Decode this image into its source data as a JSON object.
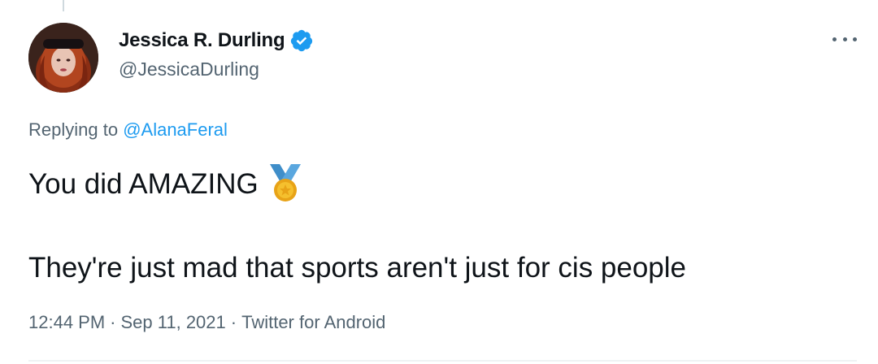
{
  "author": {
    "display_name": "Jessica R. Durling",
    "handle": "@JessicaDurling",
    "verified": true
  },
  "reply": {
    "prefix": "Replying to ",
    "mention": "@AlanaFeral"
  },
  "tweet": {
    "line1": "You did AMAZING",
    "line1_emoji": "medal-icon",
    "line2": "They're just mad that sports aren't just for cis people"
  },
  "meta": {
    "time": "12:44 PM",
    "separator": "·",
    "date": "Sep 11, 2021",
    "source": "Twitter for Android"
  },
  "icons": {
    "verified": "verified-badge-icon",
    "more": "more-options-icon",
    "medal": "sports-medal-icon"
  },
  "colors": {
    "accent": "#1d9bf0",
    "text": "#0f1419",
    "secondary": "#536471"
  }
}
